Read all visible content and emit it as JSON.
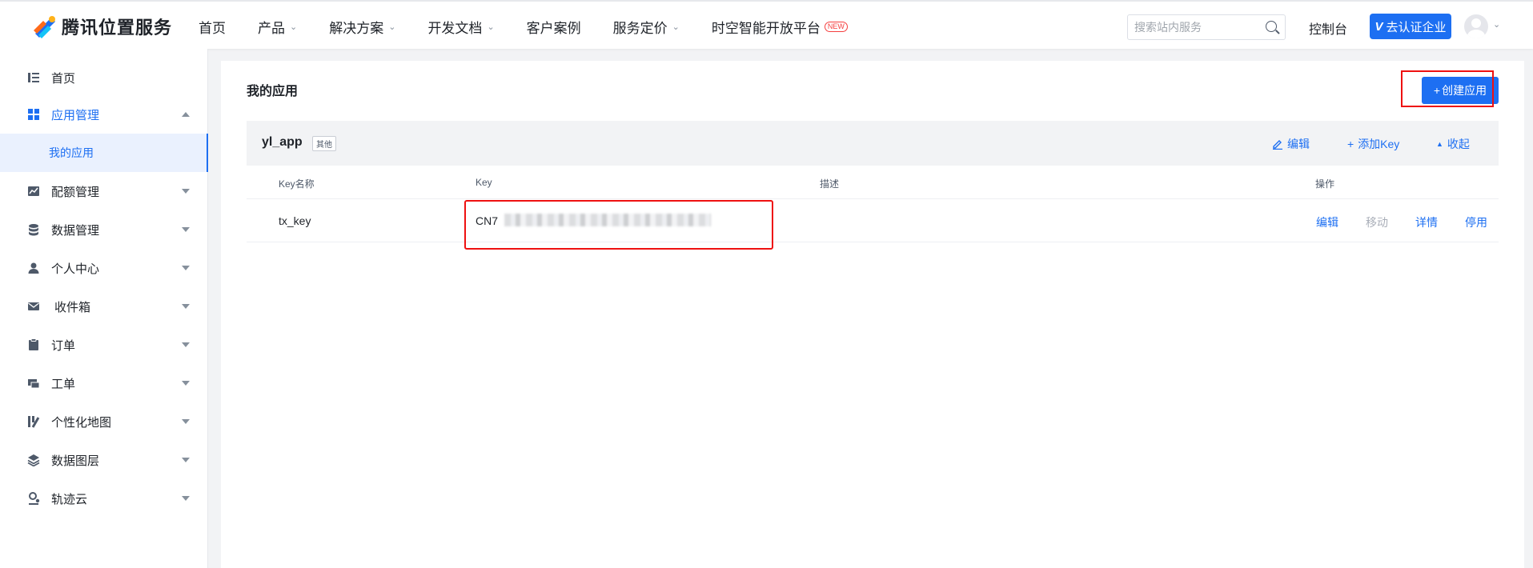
{
  "header": {
    "logo_text": "腾讯位置服务",
    "nav": [
      {
        "label": "首页",
        "has_dropdown": false
      },
      {
        "label": "产品",
        "has_dropdown": true
      },
      {
        "label": "解决方案",
        "has_dropdown": true
      },
      {
        "label": "开发文档",
        "has_dropdown": true
      },
      {
        "label": "客户案例",
        "has_dropdown": false
      },
      {
        "label": "服务定价",
        "has_dropdown": true
      },
      {
        "label": "时空智能开放平台",
        "has_dropdown": false,
        "badge": "NEW"
      }
    ],
    "search_placeholder": "搜索站内服务",
    "console_label": "控制台",
    "certify_icon": "V",
    "certify_label": "去认证企业"
  },
  "sidebar": {
    "items": [
      {
        "label": "首页",
        "icon": "list-icon"
      },
      {
        "label": "应用管理",
        "icon": "grid-icon",
        "expanded": true,
        "active": true
      },
      {
        "label": "配额管理",
        "icon": "chart-icon"
      },
      {
        "label": "数据管理",
        "icon": "database-icon"
      },
      {
        "label": "个人中心",
        "icon": "user-icon"
      },
      {
        "label": "收件箱",
        "icon": "mail-icon"
      },
      {
        "label": "订单",
        "icon": "clipboard-icon"
      },
      {
        "label": "工单",
        "icon": "ticket-icon"
      },
      {
        "label": "个性化地图",
        "icon": "map-style-icon"
      },
      {
        "label": "数据图层",
        "icon": "layers-icon"
      },
      {
        "label": "轨迹云",
        "icon": "track-icon"
      }
    ],
    "sub_item": "我的应用"
  },
  "main": {
    "title": "我的应用",
    "create_button": "创建应用",
    "app": {
      "name": "yl_app",
      "tag": "其他",
      "actions": {
        "edit": "编辑",
        "add_key": "添加Key",
        "collapse": "收起"
      }
    },
    "table": {
      "columns": [
        "Key名称",
        "Key",
        "描述",
        "操作"
      ],
      "rows": [
        {
          "name": "tx_key",
          "key": "CN7",
          "description": "",
          "ops": [
            "编辑",
            "移动",
            "详情",
            "停用"
          ]
        }
      ]
    }
  },
  "colors": {
    "accent": "#1d6ff2",
    "highlight": "#ee1111"
  }
}
